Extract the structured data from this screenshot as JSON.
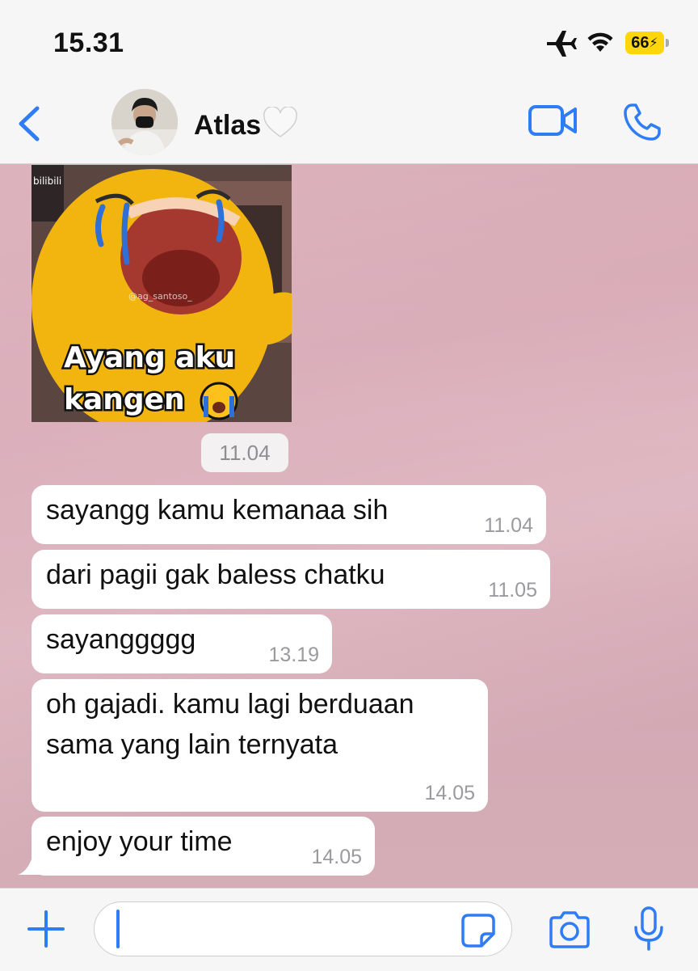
{
  "status_bar": {
    "time": "15.31",
    "battery": "66",
    "icons": [
      "airplane-mode-icon",
      "wifi-icon",
      "battery-charging-icon"
    ]
  },
  "header": {
    "contact_name": "Atlas",
    "name_emoji": "white-heart-icon",
    "actions": [
      "video-call-icon",
      "voice-call-icon"
    ]
  },
  "chat": {
    "sticker": {
      "caption_line1": "Ayang aku",
      "caption_line2": "kangen",
      "watermark": "@ag_santoso_",
      "corner_logo": "bilibili"
    },
    "date_chip": "11.04",
    "messages": [
      {
        "text": "sayangg kamu kemanaa sih",
        "time": "11.04"
      },
      {
        "text": "dari pagii gak baless chatku",
        "time": "11.05"
      },
      {
        "text": "sayanggggg",
        "time": "13.19"
      },
      {
        "text": "oh gajadi. kamu lagi berduaan\nsama yang lain ternyata",
        "time": "14.05"
      },
      {
        "text": "enjoy your time",
        "time": "14.05"
      }
    ]
  },
  "input_bar": {
    "placeholder": "",
    "icons": [
      "plus-icon",
      "sticker-icon",
      "camera-icon",
      "microphone-icon"
    ]
  },
  "colors": {
    "accent": "#2e7cf6",
    "chat_background": "#d9adb8",
    "bubble": "#ffffff",
    "battery": "#ffd60a"
  }
}
